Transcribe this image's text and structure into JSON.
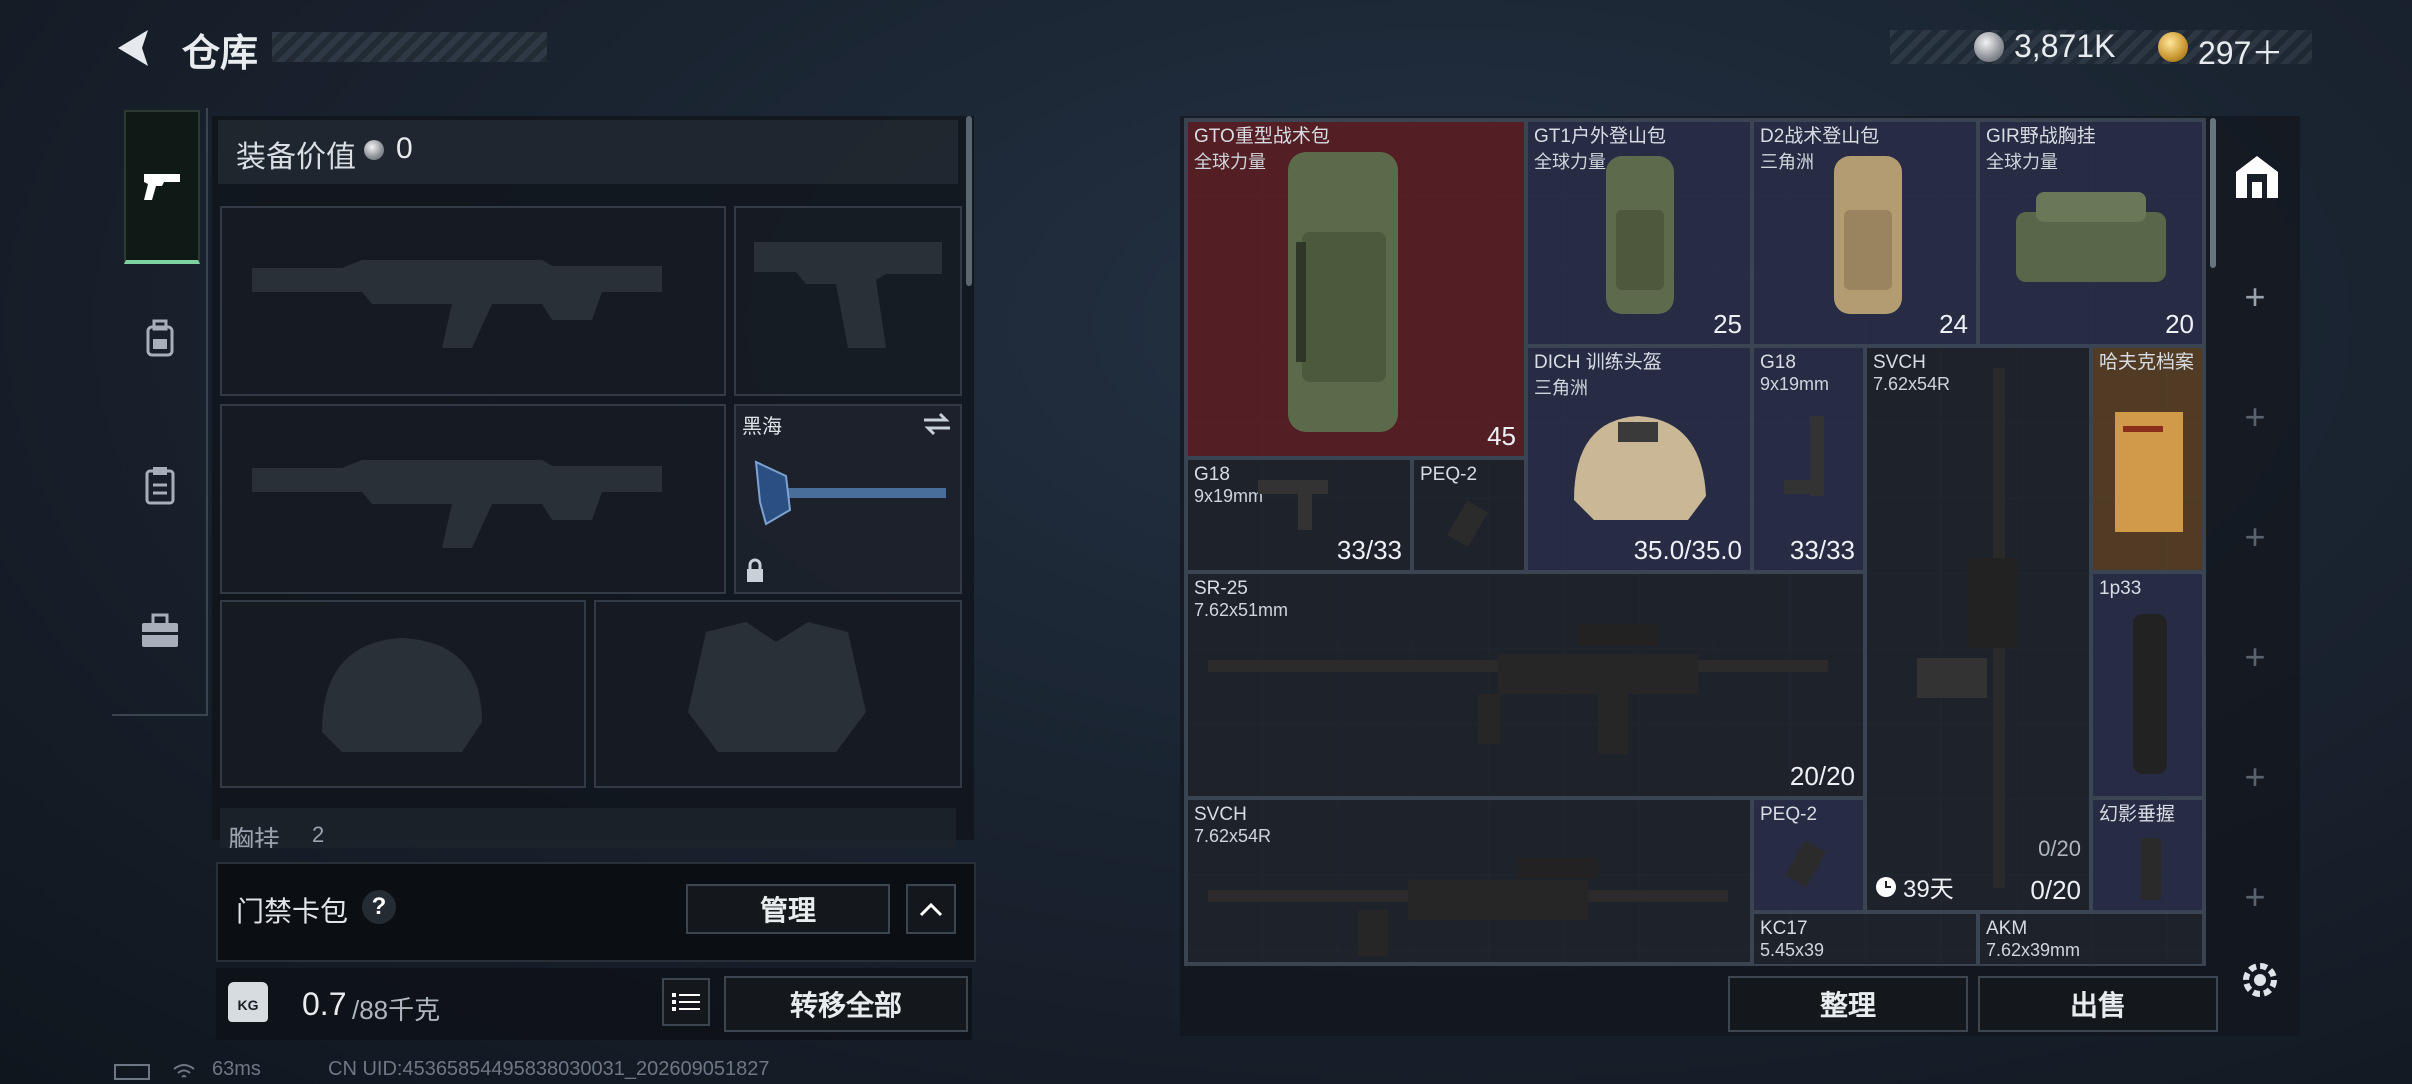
{
  "header": {
    "title": "仓库",
    "currencies": [
      {
        "icon": "silver-coin-icon",
        "value": "3,871K"
      },
      {
        "icon": "gold-triangle-coin-icon",
        "value": "297＋"
      }
    ]
  },
  "sidenav": {
    "items": [
      {
        "name": "weapon-tab",
        "icon": "pistol-icon",
        "active": true
      },
      {
        "name": "gear-tab",
        "icon": "backpack-icon",
        "active": false
      },
      {
        "name": "clipboard-tab",
        "icon": "clipboard-icon",
        "active": false
      },
      {
        "name": "toolbox-tab",
        "icon": "toolbox-icon",
        "active": false
      }
    ]
  },
  "equipment": {
    "value_label": "装备价值",
    "value": "0",
    "melee": {
      "label": "黑海"
    },
    "chest_label": "胸挂",
    "chest_count": "2",
    "keycard_label": "门禁卡包",
    "help": "?",
    "manage_label": "管理",
    "weight_current": "0.7",
    "weight_max": "/88千克",
    "kg_label": "KG",
    "transfer_all": "转移全部"
  },
  "stash": {
    "items": [
      {
        "name": "GTO重型战术包",
        "sub": "全球力量",
        "value": "45"
      },
      {
        "name": "GT1户外登山包",
        "sub": "全球力量",
        "value": "25"
      },
      {
        "name": "D2战术登山包",
        "sub": "三角洲",
        "value": "24"
      },
      {
        "name": "GIR野战胸挂",
        "sub": "全球力量",
        "value": "20"
      },
      {
        "name": "DICH 训练头盔",
        "sub": "三角洲",
        "value": "35.0/35.0"
      },
      {
        "name": "G18",
        "sub": "9x19mm",
        "value": "33/33"
      },
      {
        "name": "SVCH",
        "sub": "7.62x54R",
        "value": "0/20"
      },
      {
        "name": "哈夫克档案",
        "sub": "",
        "value": ""
      },
      {
        "name": "G18",
        "sub": "9x19mm",
        "value": "33/33"
      },
      {
        "name": "PEQ-2",
        "sub": "",
        "value": ""
      },
      {
        "name": "SR-25",
        "sub": "7.62x51mm",
        "value": "20/20"
      },
      {
        "name": "1p33",
        "sub": "",
        "value": ""
      },
      {
        "name": "SVCH",
        "sub": "7.62x54R",
        "value": ""
      },
      {
        "name": "PEQ-2",
        "sub": "",
        "value": ""
      },
      {
        "name": "幻影垂握",
        "sub": "",
        "value": ""
      },
      {
        "name": "KC17",
        "sub": "5.45x39",
        "value": ""
      },
      {
        "name": "AKM",
        "sub": "7.62x39mm",
        "value": ""
      }
    ],
    "timer": "39天",
    "svch_ammo_small": "0/20",
    "organize": "整理",
    "sell": "出售"
  },
  "status": {
    "ping": "63ms",
    "uid": "CN UID:45365854495838030031_202609051827"
  }
}
